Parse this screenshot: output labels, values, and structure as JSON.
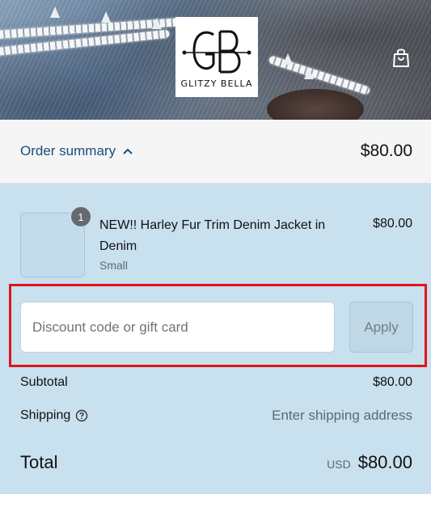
{
  "header": {
    "logo_monogram": "GB",
    "logo_text": "GLITZY BELLA",
    "cart_icon": "shopping-bag-icon"
  },
  "summary": {
    "toggle_label": "Order summary",
    "toggle_icon": "chevron-up-icon",
    "total": "$80.00"
  },
  "product": {
    "quantity": "1",
    "name": "NEW!! Harley Fur Trim Denim Jacket in Denim",
    "variant": "Small",
    "price": "$80.00"
  },
  "discount": {
    "placeholder": "Discount code or gift card",
    "apply_label": "Apply"
  },
  "costs": {
    "subtotal_label": "Subtotal",
    "subtotal_value": "$80.00",
    "shipping_label": "Shipping",
    "shipping_icon": "help-circle-icon",
    "shipping_value": "Enter shipping address",
    "total_label": "Total",
    "currency": "USD",
    "total_value": "$80.00"
  },
  "colors": {
    "link": "#1a4d7a",
    "panel_bg": "#c9e0ee",
    "highlight": "#e0141b"
  }
}
